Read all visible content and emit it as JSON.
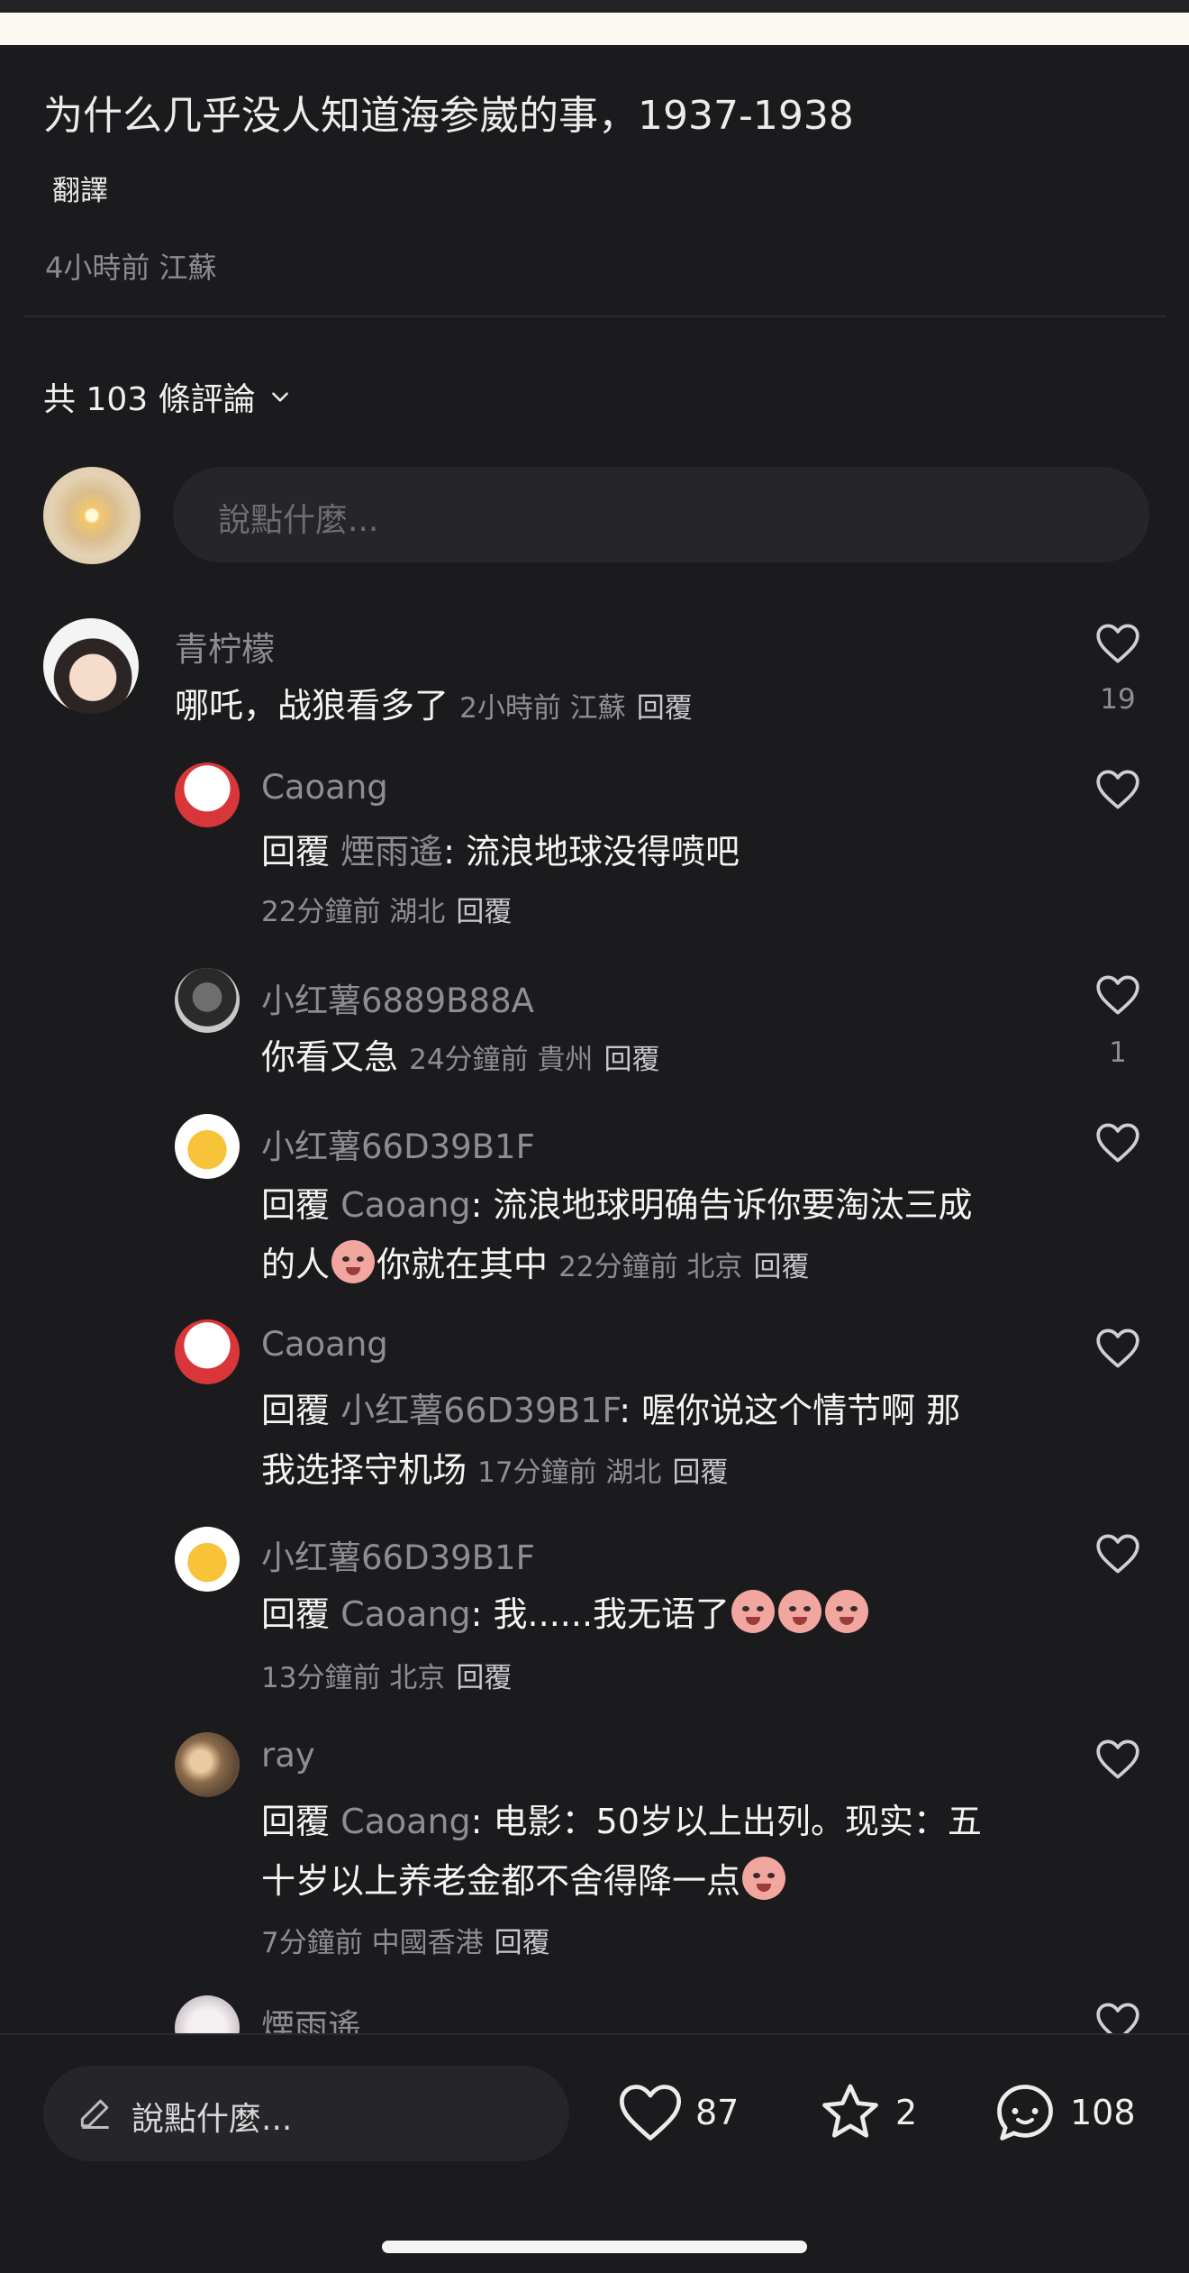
{
  "post": {
    "title": "为什么几乎没人知道海参崴的事，1937-1938",
    "translate_label": "翻譯",
    "meta": "4小時前 江蘇"
  },
  "comments_header": {
    "count_label": "共 103 條評論"
  },
  "compose": {
    "placeholder": "說點什麼..."
  },
  "comments": [
    {
      "user": "青柠檬",
      "text": "哪吒，战狼看多了",
      "meta": "2小時前 江蘇",
      "reply": "回覆",
      "likes": "19"
    },
    {
      "user": "Caoang",
      "prefix": "回覆",
      "target": "煙雨遙",
      "text": ": 流浪地球没得喷吧",
      "meta": "22分鐘前 湖北",
      "reply": "回覆",
      "likes": ""
    },
    {
      "user": "小红薯6889B88A",
      "text": "你看又急",
      "meta": "24分鐘前 貴州",
      "reply": "回覆",
      "likes": "1"
    },
    {
      "user": "小红薯66D39B1F",
      "prefix": "回覆",
      "target": "Caoang",
      "text": ": 流浪地球明确告诉你要淘汰三成",
      "text2a": "的人",
      "text2b": "你就在其中",
      "meta": "22分鐘前 北京",
      "reply": "回覆",
      "likes": ""
    },
    {
      "user": "Caoang",
      "prefix": "回覆",
      "target": "小红薯66D39B1F",
      "text": ": 喔你说这个情节啊 那",
      "text2": "我选择守机场",
      "meta": "17分鐘前 湖北",
      "reply": "回覆",
      "likes": ""
    },
    {
      "user": "小红薯66D39B1F",
      "prefix": "回覆",
      "target": "Caoang",
      "text": ": 我......我无语了",
      "meta": "13分鐘前 北京",
      "reply": "回覆",
      "likes": ""
    },
    {
      "user": "ray",
      "prefix": "回覆",
      "target": "Caoang",
      "text": ": 电影：50岁以上出列。现实：五",
      "text2": "十岁以上养老金都不舍得降一点",
      "meta": "7分鐘前 中國香港",
      "reply": "回覆",
      "likes": ""
    },
    {
      "user": "煙雨遙"
    }
  ],
  "bottom_bar": {
    "compose_placeholder": "說點什麼...",
    "likes": "87",
    "favorites": "2",
    "comments": "108"
  },
  "icons": [
    "chevron-down-icon",
    "heart-icon",
    "star-icon",
    "chat-bubble-icon",
    "pencil-icon",
    "crying-emoji-icon"
  ]
}
